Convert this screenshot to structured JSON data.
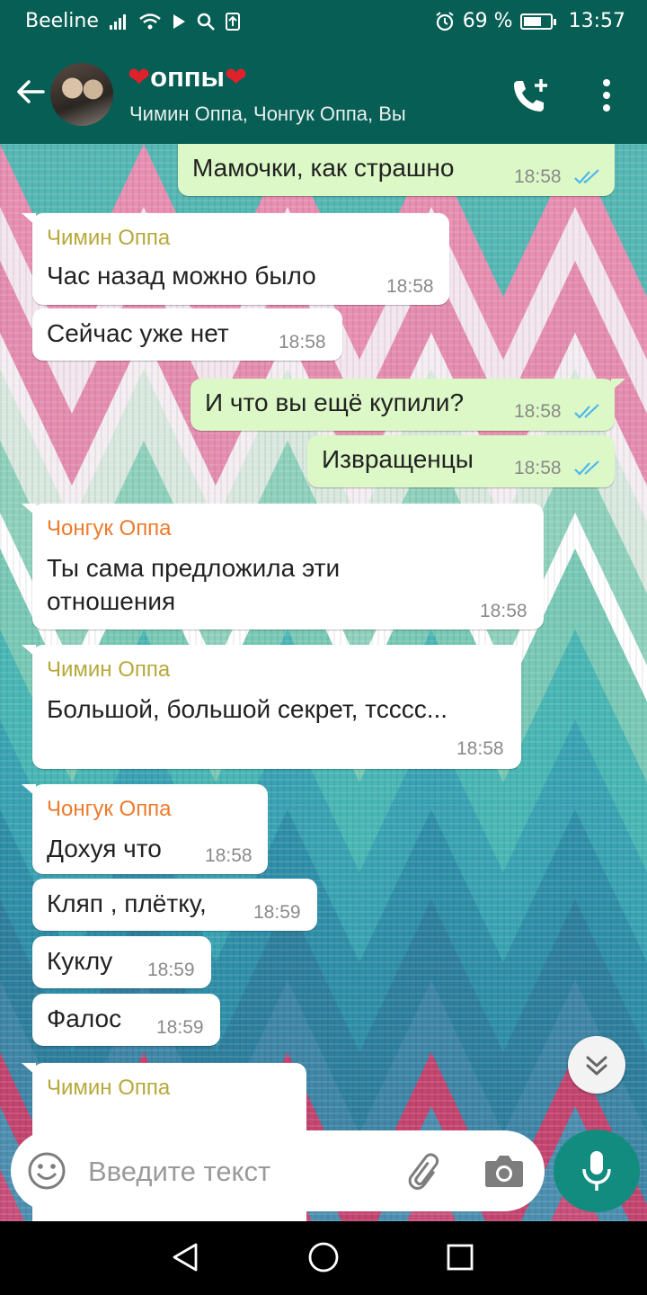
{
  "status_bar": {
    "carrier": "Beeline",
    "battery_percent": "69 %",
    "battery_level": 0.69,
    "time": "13:57",
    "icons": [
      "signal-icon",
      "wifi-icon",
      "play-icon",
      "search-icon",
      "upload-icon",
      "alarm-icon",
      "battery-icon"
    ]
  },
  "header": {
    "title": "оппы",
    "title_decoration": "heart-emoji",
    "participants": "Чимин Оппа, Чонгук Оппа, Вы"
  },
  "messages": [
    {
      "direction": "out",
      "text": "Мамочки, как страшно",
      "time": "18:58",
      "status": "read"
    },
    {
      "direction": "in",
      "sender": "Чимин Оппа",
      "text": "Час назад можно было",
      "time": "18:58"
    },
    {
      "direction": "in",
      "text": "Сейчас уже нет",
      "time": "18:58"
    },
    {
      "direction": "out",
      "text": "И что вы ещё купили?",
      "time": "18:58",
      "status": "read"
    },
    {
      "direction": "out",
      "text": "Извращенцы",
      "time": "18:58",
      "status": "read"
    },
    {
      "direction": "in",
      "sender": "Чонгук Оппа",
      "text_line1": "Ты сама предложила эти",
      "text_line2": "отношения",
      "time": "18:58"
    },
    {
      "direction": "in",
      "sender": "Чимин Оппа",
      "text": "Большой, большой секрет, тсссс...",
      "time": "18:58"
    },
    {
      "direction": "in",
      "sender": "Чонгук Оппа",
      "text": "Дохуя что",
      "time": "18:58"
    },
    {
      "direction": "in",
      "text": "Кляп , плётку,",
      "time": "18:59"
    },
    {
      "direction": "in",
      "text": "Куклу",
      "time": "18:59"
    },
    {
      "direction": "in",
      "text": "Фалос",
      "time": "18:59"
    },
    {
      "direction": "in",
      "sender": "Чимин Оппа",
      "text": ""
    }
  ],
  "composer": {
    "placeholder": "Введите текст"
  },
  "colors": {
    "header": "#075e54",
    "outgoing_bubble": "#dcf8c6",
    "incoming_bubble": "#ffffff",
    "jimin_name": "#b7a83a",
    "jungkook_name": "#ee7a2c",
    "read_ticks": "#4fb6ec",
    "mic_button": "#128c7e"
  }
}
